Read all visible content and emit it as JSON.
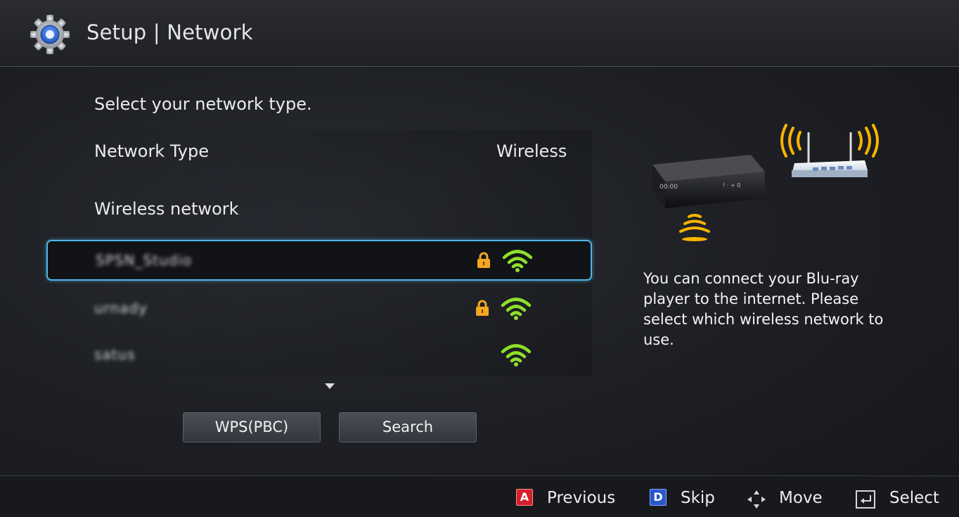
{
  "header": {
    "title": "Setup | Network",
    "icon": "gear-icon"
  },
  "prompt": "Select your network type.",
  "network_type": {
    "label": "Network Type",
    "value": "Wireless"
  },
  "wireless_section": {
    "label": "Wireless network"
  },
  "networks": [
    {
      "ssid": "SPSN_Studio",
      "secured": true,
      "icon": "wifi-signal-icon",
      "selected": true
    },
    {
      "ssid": "urnady",
      "secured": true,
      "icon": "wifi-signal-icon",
      "selected": false
    },
    {
      "ssid": "satus",
      "secured": false,
      "icon": "wifi-signal-icon",
      "selected": false
    }
  ],
  "buttons": {
    "wps": "WPS(PBC)",
    "search": "Search"
  },
  "info_text": "You can connect your Blu-ray player to the internet. Please select which wireless network to use.",
  "footer": {
    "previous": {
      "key": "A",
      "label": "Previous",
      "color": "#d3202d"
    },
    "skip": {
      "key": "D",
      "label": "Skip",
      "color": "#2a56c8"
    },
    "move": {
      "label": "Move",
      "icon": "dpad-icon"
    },
    "select": {
      "label": "Select",
      "icon": "enter-icon"
    }
  },
  "colors": {
    "selection": "#4fb6e8",
    "wifi": "#8ee02a",
    "lock": "#f5a623",
    "signal_waves": "#f7b500"
  }
}
